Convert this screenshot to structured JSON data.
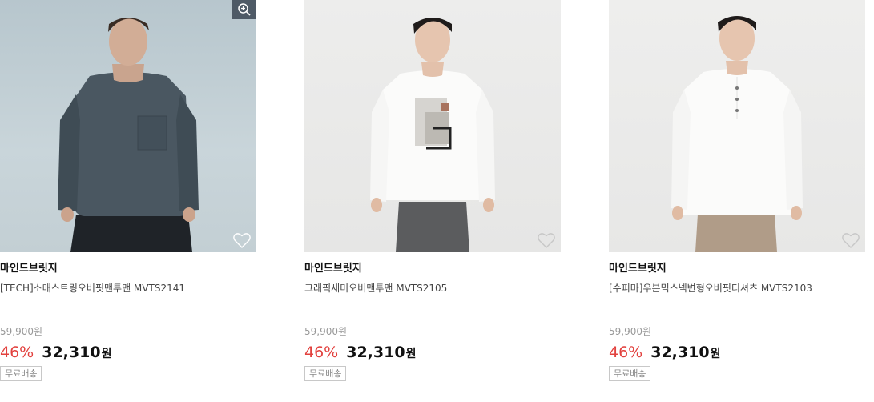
{
  "products": [
    {
      "brand": "마인드브릿지",
      "name": "[TECH]소매스트링오버핏맨투맨 MVTS2141",
      "original_price": "59,900원",
      "discount": "46%",
      "sale_price": "32,310",
      "currency": "원",
      "badge": "무료배송",
      "has_zoom": true
    },
    {
      "brand": "마인드브릿지",
      "name": "그래픽세미오버맨투맨 MVTS2105",
      "original_price": "59,900원",
      "discount": "46%",
      "sale_price": "32,310",
      "currency": "원",
      "badge": "무료배송",
      "has_zoom": false
    },
    {
      "brand": "마인드브릿지",
      "name": "[수피마]우븐믹스넥변형오버핏티셔츠 MVTS2103",
      "original_price": "59,900원",
      "discount": "46%",
      "sale_price": "32,310",
      "currency": "원",
      "badge": "무료배송",
      "has_zoom": false
    }
  ],
  "icons": {
    "zoom": "zoom-in-icon",
    "wishlist": "heart-outline-icon"
  },
  "colors": {
    "discount": "#e2413e",
    "zoom_bg": "#4e5a66"
  }
}
